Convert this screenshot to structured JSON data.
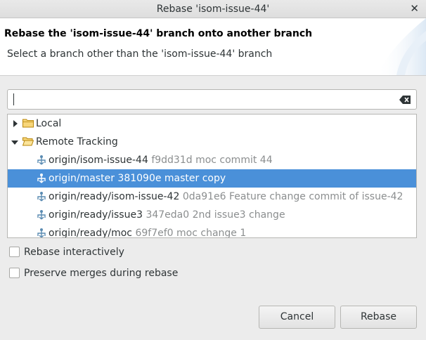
{
  "window": {
    "title": "Rebase 'isom-issue-44'"
  },
  "header": {
    "title": "Rebase the 'isom-issue-44' branch onto another branch",
    "description": "Select a branch other than the 'isom-issue-44' branch"
  },
  "filter": {
    "value": "",
    "placeholder": ""
  },
  "tree": {
    "local": {
      "label": "Local",
      "expanded": false
    },
    "remote": {
      "label": "Remote Tracking",
      "expanded": true
    },
    "branches": [
      {
        "name": "origin/isom-issue-44",
        "info": "f9dd31d moc commit 44",
        "selected": false
      },
      {
        "name": "origin/master",
        "info": "381090e master copy",
        "selected": true
      },
      {
        "name": "origin/ready/isom-issue-42",
        "info": "0da91e6 Feature change commit of issue-42",
        "selected": false
      },
      {
        "name": "origin/ready/issue3",
        "info": "347eda0 2nd issue3 change",
        "selected": false
      },
      {
        "name": "origin/ready/moc",
        "info": "69f7ef0 moc change 1",
        "selected": false
      }
    ]
  },
  "options": {
    "interactive": {
      "label": "Rebase interactively",
      "checked": false
    },
    "preserve_merges": {
      "label": "Preserve merges during rebase",
      "checked": false
    }
  },
  "buttons": {
    "cancel": "Cancel",
    "rebase": "Rebase"
  },
  "colors": {
    "selection": "#4a90d9",
    "folder": "#e8b952",
    "branch_icon": "#5a8bb2"
  }
}
